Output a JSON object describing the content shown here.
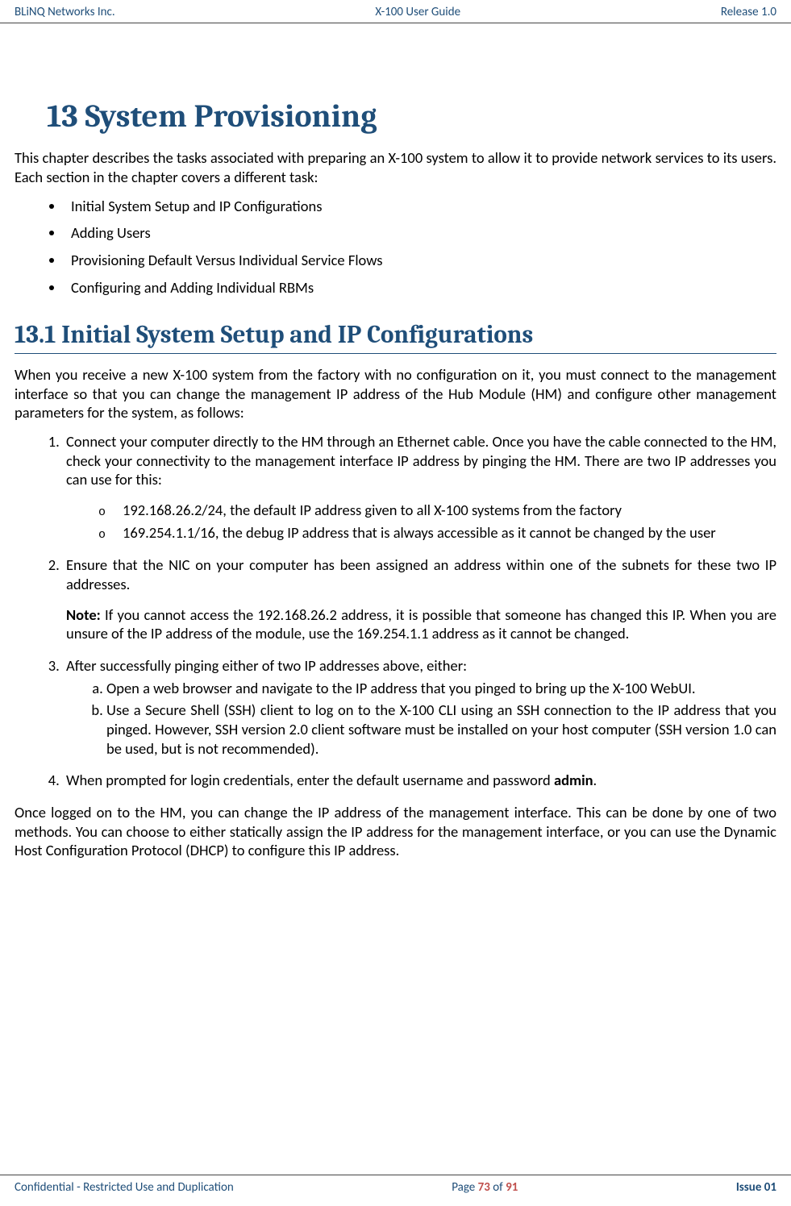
{
  "header": {
    "left": "BLiNQ Networks Inc.",
    "center": "X-100 User Guide",
    "right": "Release 1.0"
  },
  "chapter": {
    "title": "13 System Provisioning",
    "intro": "This chapter describes the tasks associated with preparing an X-100 system to allow it to provide network services to its users. Each section in the chapter covers a different task:",
    "bullets": [
      "Initial System Setup and IP Configurations",
      "Adding Users",
      "Provisioning Default Versus Individual Service Flows",
      "Configuring and Adding Individual RBMs"
    ]
  },
  "section": {
    "title": "13.1 Initial System Setup and IP Configurations",
    "intro": "When you receive a new X-100 system from the factory with no configuration on it, you must connect to the management interface so that you can change the management IP address of the Hub Module (HM) and configure other management parameters for the system, as follows:",
    "step1": "Connect your computer directly to the HM through an Ethernet cable. Once you have the cable connected to the HM, check your connectivity to the management interface IP address by pinging the HM. There are two IP addresses you can use for this:",
    "step1_sub1": "192.168.26.2/24, the default IP address given to all X-100 systems from the factory",
    "step1_sub2": "169.254.1.1/16, the debug IP address that is always accessible as it cannot be changed by the user",
    "step2": "Ensure that the NIC on your computer has been assigned an address within one of the subnets for these two IP addresses.",
    "note_label": "Note:",
    "note_text": " If you cannot access the 192.168.26.2 address, it is possible that someone has changed this IP. When you are unsure of the IP address of the module, use the 169.254.1.1 address as it cannot be changed.",
    "step3": "After successfully pinging either of two IP addresses above, either:",
    "step3_a": "Open a web browser and navigate to the IP address that you pinged to bring up the X-100 WebUI.",
    "step3_b": "Use a Secure Shell (SSH) client to log on to the X-100 CLI using an SSH connection to the IP address that you pinged. However, SSH version 2.0 client software must be installed on your host computer (SSH version 1.0 can be used, but is not recommended).",
    "step4_pre": "When prompted for login credentials, enter the default username and password ",
    "step4_bold": "admin",
    "step4_post": ".",
    "outro": "Once logged on to the HM, you can change the IP address of the management interface. This can be done by one of two methods. You can choose to either statically assign the IP address for the management interface, or you can use the Dynamic Host Configuration Protocol (DHCP) to configure this IP address."
  },
  "footer": {
    "left": "Confidential - Restricted Use and Duplication",
    "center_pre": "Page ",
    "center_num": "73",
    "center_mid": " of ",
    "center_total": "91",
    "right": "Issue 01"
  }
}
